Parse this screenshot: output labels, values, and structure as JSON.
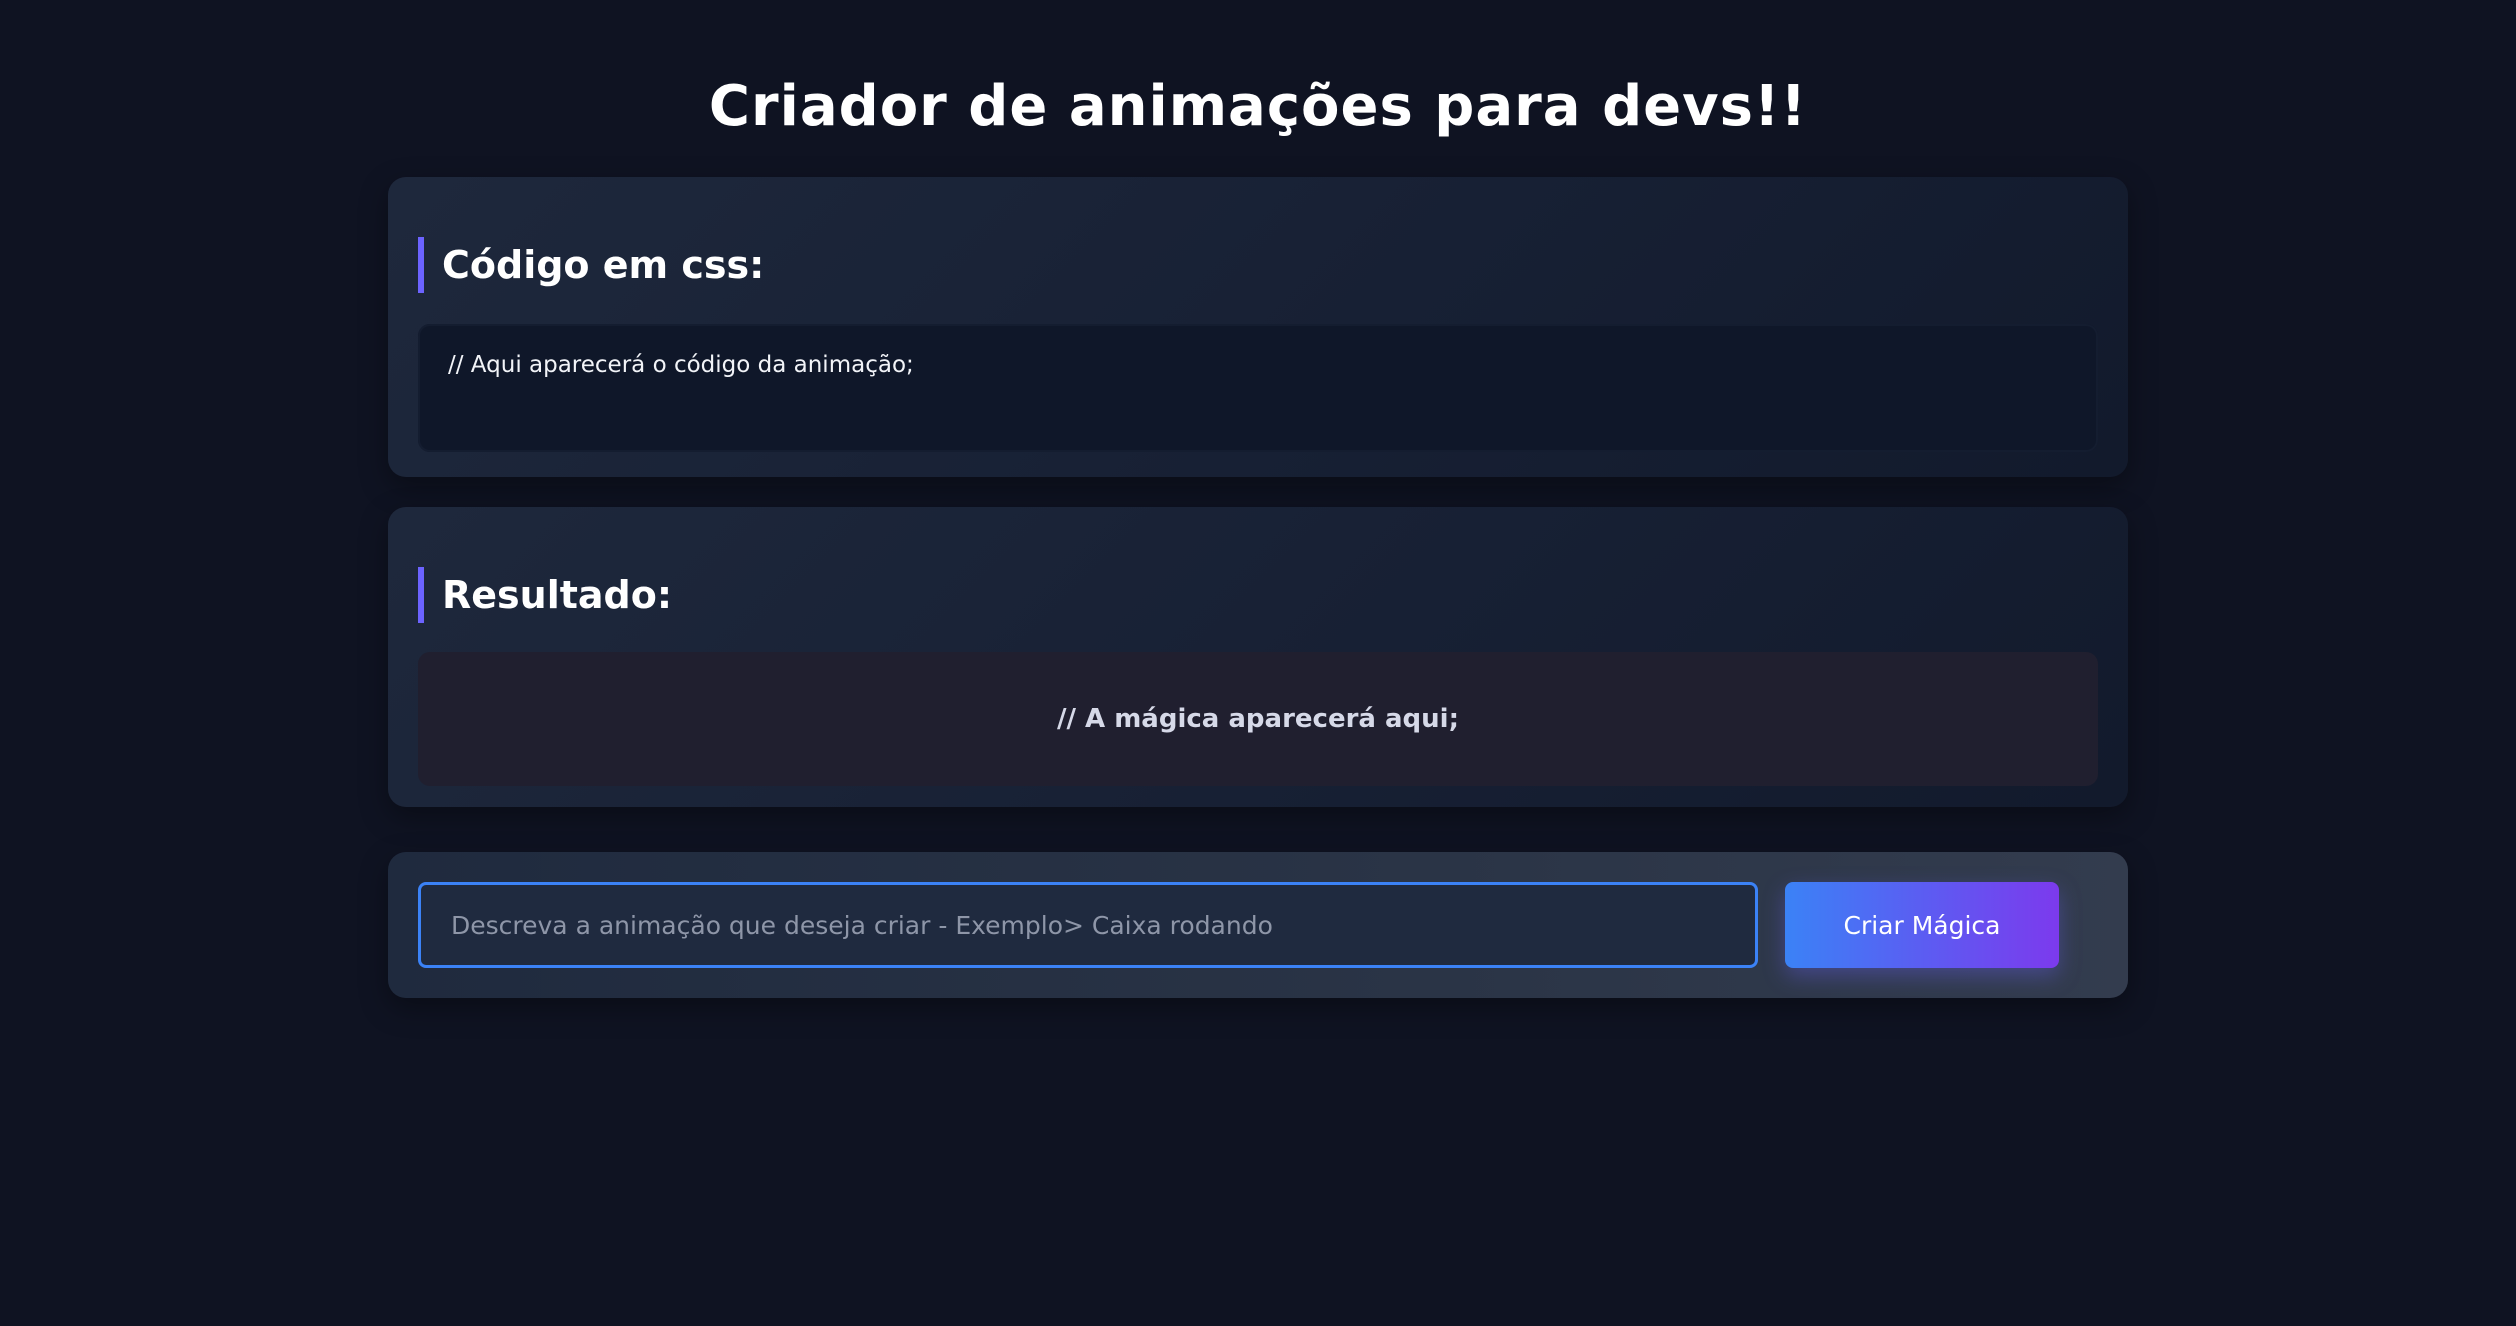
{
  "header": {
    "title": "Criador de animações para devs!!"
  },
  "code_section": {
    "heading": "Código em css:",
    "code_placeholder": "// Aqui aparecerá o código da animação;"
  },
  "result_section": {
    "heading": "Resultado:",
    "result_placeholder": "// A mágica aparecerá aqui;"
  },
  "prompt": {
    "placeholder": "Descreva a animação que deseja criar - Exemplo> Caixa rodando",
    "value": "",
    "button_label": "Criar Mágica"
  },
  "colors": {
    "background": "#0f1322",
    "accent_bar": "#6c63ff",
    "input_border": "#3b82f6",
    "button_gradient_start": "#3b82f6",
    "button_gradient_end": "#7c3aed"
  }
}
